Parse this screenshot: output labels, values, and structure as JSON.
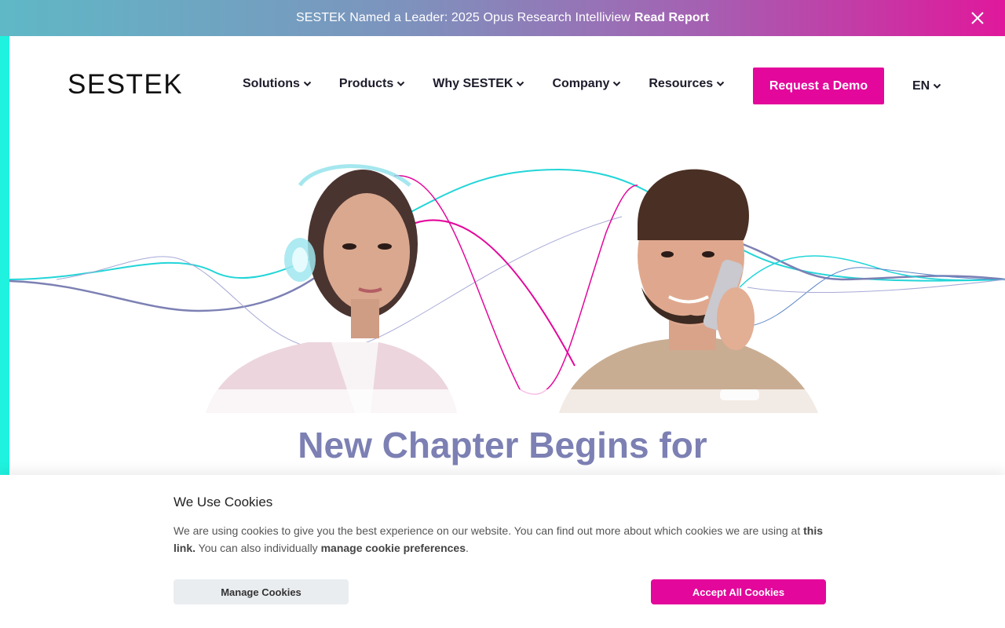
{
  "announcement": {
    "text": "SESTEK Named a Leader: 2025 Opus Research Intelliview",
    "link": "Read Report"
  },
  "header": {
    "logo": "SESTEK",
    "nav": [
      "Solutions",
      "Products",
      "Why SESTEK",
      "Company",
      "Resources"
    ],
    "cta": "Request a Demo",
    "language": "EN"
  },
  "hero": {
    "title": "New Chapter Begins for"
  },
  "cookies": {
    "title": "We Use Cookies",
    "text_1": "We are using cookies to give you the best experience on our website. You can find out more about which cookies we are using at ",
    "link_1": "this link.",
    "text_2": " You can also individually ",
    "link_2": "manage cookie preferences",
    "text_3": ".",
    "manage_label": "Manage Cookies",
    "accept_label": "Accept All Cookies"
  },
  "colors": {
    "accent": "#e3079b",
    "strip": "#1ff2de",
    "title": "#7c80b3"
  }
}
